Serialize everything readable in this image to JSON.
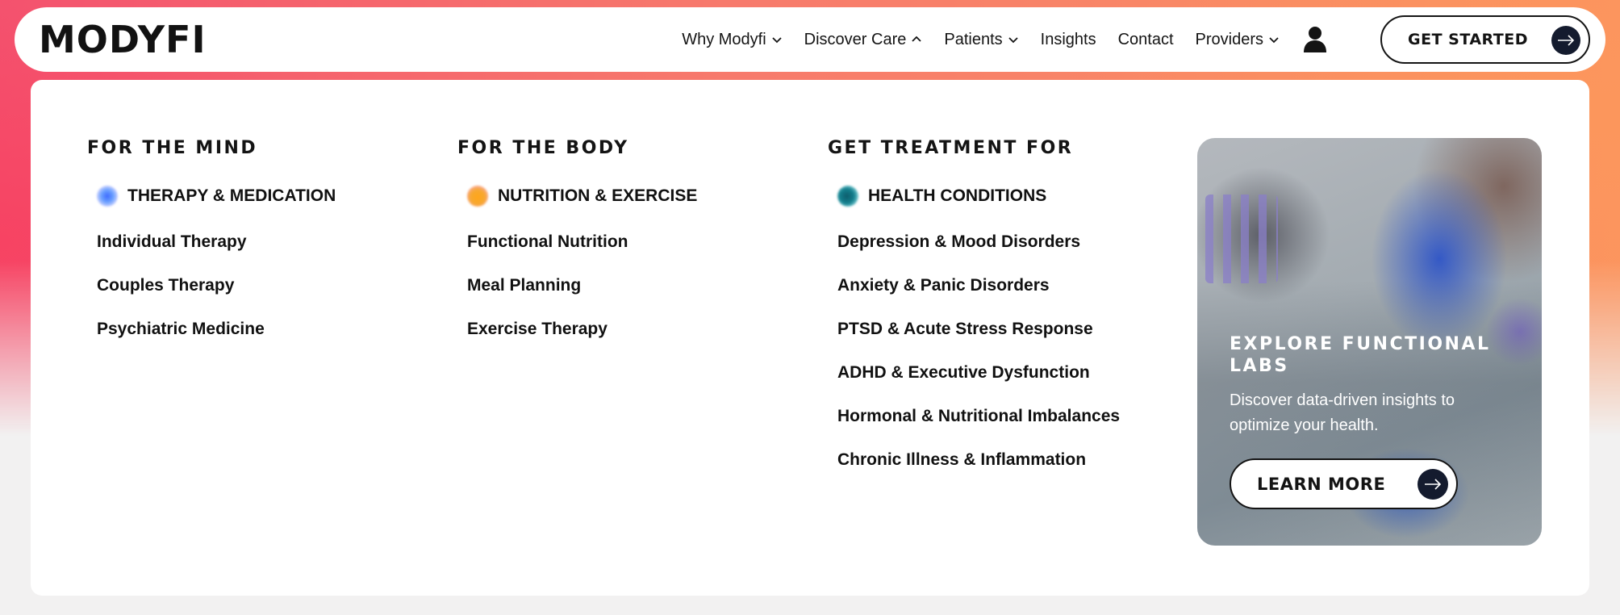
{
  "brand": {
    "logo_text": "MODYFI",
    "accent": "#141b2e"
  },
  "nav": {
    "items": [
      {
        "label": "Why Modyfi",
        "chevron": "down"
      },
      {
        "label": "Discover Care",
        "chevron": "up"
      },
      {
        "label": "Patients",
        "chevron": "down"
      },
      {
        "label": "Insights",
        "chevron": ""
      },
      {
        "label": "Contact",
        "chevron": ""
      },
      {
        "label": "Providers",
        "chevron": "down"
      }
    ],
    "user_icon": "user-icon",
    "cta_label": "GET STARTED"
  },
  "menu": {
    "columns": [
      {
        "heading": "FOR THE MIND",
        "category": "THERAPY & MEDICATION",
        "links": [
          "Individual Therapy",
          "Couples Therapy",
          "Psychiatric Medicine"
        ]
      },
      {
        "heading": "FOR THE BODY",
        "category": "NUTRITION & EXERCISE",
        "links": [
          "Functional Nutrition",
          "Meal Planning",
          "Exercise Therapy"
        ]
      },
      {
        "heading": "GET TREATMENT FOR",
        "category": "HEALTH CONDITIONS",
        "links": [
          "Depression & Mood Disorders",
          "Anxiety & Panic Disorders",
          "PTSD & Acute Stress Response",
          "ADHD & Executive Dysfunction",
          "Hormonal & Nutritional Imbalances",
          "Chronic Illness & Inflammation"
        ]
      }
    ],
    "promo": {
      "title": "EXPLORE FUNCTIONAL LABS",
      "description": "Discover data-driven insights to optimize your health.",
      "button_label": "LEARN MORE"
    }
  }
}
